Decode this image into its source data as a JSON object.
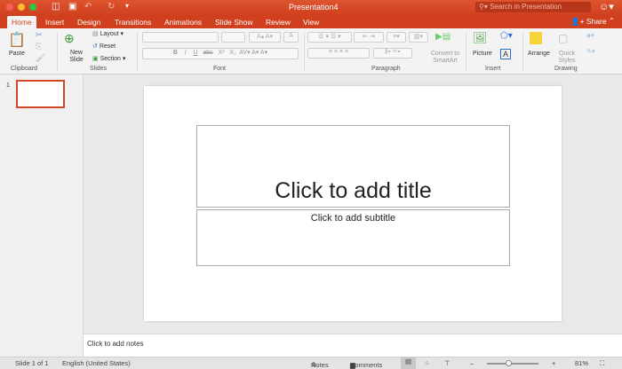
{
  "window": {
    "title": "Presentation4",
    "search_placeholder": "Search in Presentation",
    "share_label": "Share"
  },
  "tabs": [
    "Home",
    "Insert",
    "Design",
    "Transitions",
    "Animations",
    "Slide Show",
    "Review",
    "View"
  ],
  "ribbon": {
    "clipboard": {
      "paste": "Paste",
      "group": "Clipboard"
    },
    "slides": {
      "new_slide": "New Slide",
      "layout": "Layout",
      "reset": "Reset",
      "section": "Section",
      "group": "Slides"
    },
    "font": {
      "group": "Font",
      "bold": "B",
      "italic": "I",
      "underline": "U",
      "strike": "abc",
      "superscript": "X²",
      "subscript": "X₂"
    },
    "paragraph": {
      "group": "Paragraph",
      "convert": "Convert to SmartArt"
    },
    "insert": {
      "group": "Insert",
      "picture": "Picture"
    },
    "drawing": {
      "group": "Drawing",
      "arrange": "Arrange",
      "quick_styles": "Quick Styles"
    }
  },
  "thumbnail": {
    "number": "1"
  },
  "slide": {
    "title_placeholder": "Click to add title",
    "subtitle_placeholder": "Click to add subtitle"
  },
  "notes": {
    "placeholder": "Click to add notes"
  },
  "status": {
    "slide": "Slide 1 of 1",
    "language": "English (United States)",
    "notes": "Notes",
    "comments": "Comments",
    "zoom": "81%",
    "zoom_percent": 81
  },
  "colors": {
    "accent": "#d24726"
  }
}
